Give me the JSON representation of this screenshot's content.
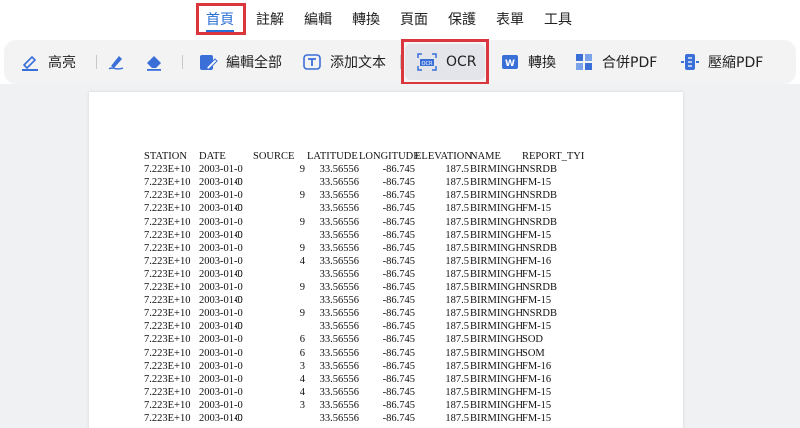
{
  "menu": {
    "items": [
      "首頁",
      "註解",
      "編輯",
      "轉換",
      "頁面",
      "保護",
      "表單",
      "工具"
    ]
  },
  "toolbar": {
    "highlight": "高亮",
    "edit_all": "編輯全部",
    "add_text": "添加文本",
    "ocr": "OCR",
    "convert": "轉換",
    "merge_pdf": "合併PDF",
    "compress_pdf": "壓縮PDF"
  },
  "colors": {
    "accent": "#2a6fd6",
    "highlight_red": "#d9363e"
  },
  "table": {
    "headers": [
      "STATION",
      "DATE",
      "SOURCE",
      "LATITUDE",
      "LONGITUDE",
      "ELEVATION",
      "NAME",
      "REPORT_TYI"
    ],
    "rows": [
      [
        "7.223E+10",
        "2003-01-0",
        "9",
        "33.56556",
        "-86.745",
        "187.5",
        "BIRMINGHAM",
        "NSRDB"
      ],
      [
        "7.223E+10",
        "2003-01-0",
        "C",
        "33.56556",
        "-86.745",
        "187.5",
        "BIRMINGHAM",
        "FM-15"
      ],
      [
        "7.223E+10",
        "2003-01-0",
        "9",
        "33.56556",
        "-86.745",
        "187.5",
        "BIRMINGHAM",
        "NSRDB"
      ],
      [
        "7.223E+10",
        "2003-01-0",
        "C",
        "33.56556",
        "-86.745",
        "187.5",
        "BIRMINGHAM",
        "FM-15"
      ],
      [
        "7.223E+10",
        "2003-01-0",
        "9",
        "33.56556",
        "-86.745",
        "187.5",
        "BIRMINGHAM",
        "NSRDB"
      ],
      [
        "7.223E+10",
        "2003-01-0",
        "C",
        "33.56556",
        "-86.745",
        "187.5",
        "BIRMINGHAM",
        "FM-15"
      ],
      [
        "7.223E+10",
        "2003-01-0",
        "9",
        "33.56556",
        "-86.745",
        "187.5",
        "BIRMINGHAM",
        "NSRDB"
      ],
      [
        "7.223E+10",
        "2003-01-0",
        "4",
        "33.56556",
        "-86.745",
        "187.5",
        "BIRMINGHAM",
        "FM-16"
      ],
      [
        "7.223E+10",
        "2003-01-0",
        "C",
        "33.56556",
        "-86.745",
        "187.5",
        "BIRMINGHAM",
        "FM-15"
      ],
      [
        "7.223E+10",
        "2003-01-0",
        "9",
        "33.56556",
        "-86.745",
        "187.5",
        "BIRMINGHAM",
        "NSRDB"
      ],
      [
        "7.223E+10",
        "2003-01-0",
        "C",
        "33.56556",
        "-86.745",
        "187.5",
        "BIRMINGHAM",
        "FM-15"
      ],
      [
        "7.223E+10",
        "2003-01-0",
        "9",
        "33.56556",
        "-86.745",
        "187.5",
        "BIRMINGHAM",
        "NSRDB"
      ],
      [
        "7.223E+10",
        "2003-01-0",
        "C",
        "33.56556",
        "-86.745",
        "187.5",
        "BIRMINGHAM",
        "FM-15"
      ],
      [
        "7.223E+10",
        "2003-01-0",
        "6",
        "33.56556",
        "-86.745",
        "187.5",
        "BIRMINGHAM",
        "SOD"
      ],
      [
        "7.223E+10",
        "2003-01-0",
        "6",
        "33.56556",
        "-86.745",
        "187.5",
        "BIRMINGHAM",
        "SOM"
      ],
      [
        "7.223E+10",
        "2003-01-0",
        "3",
        "33.56556",
        "-86.745",
        "187.5",
        "BIRMINGHAM",
        "FM-16"
      ],
      [
        "7.223E+10",
        "2003-01-0",
        "4",
        "33.56556",
        "-86.745",
        "187.5",
        "BIRMINGHAM",
        "FM-16"
      ],
      [
        "7.223E+10",
        "2003-01-0",
        "4",
        "33.56556",
        "-86.745",
        "187.5",
        "BIRMINGHAM",
        "FM-15"
      ],
      [
        "7.223E+10",
        "2003-01-0",
        "3",
        "33.56556",
        "-86.745",
        "187.5",
        "BIRMINGHAM",
        "FM-15"
      ],
      [
        "7.223E+10",
        "2003-01-0",
        "C",
        "33.56556",
        "-86.745",
        "187.5",
        "BIRMINGHAM",
        "FM-15"
      ]
    ]
  }
}
